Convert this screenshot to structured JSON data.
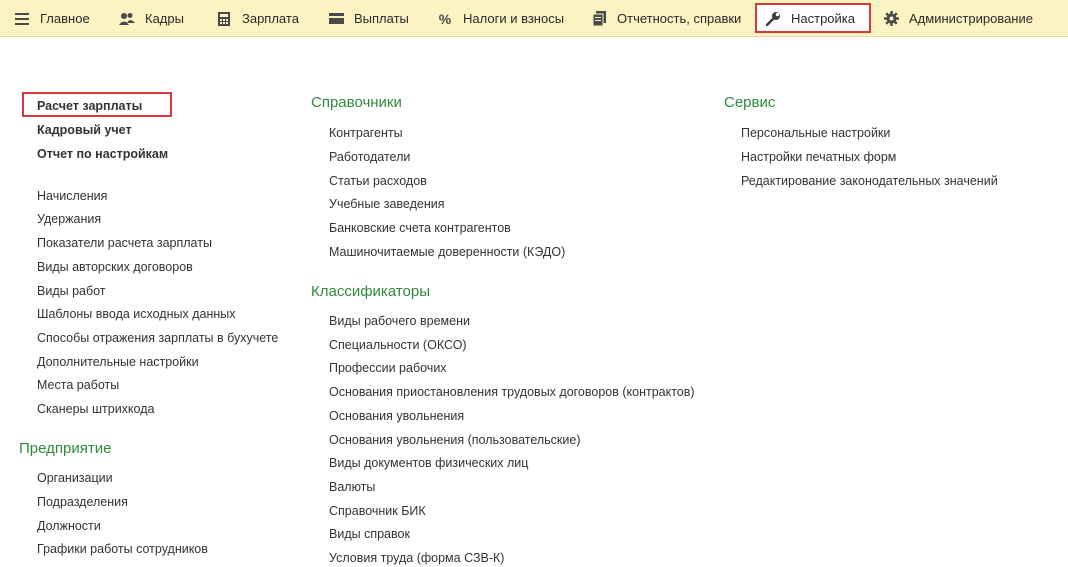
{
  "nav": {
    "main": "Главное",
    "hr": "Кадры",
    "salary": "Зарплата",
    "payments": "Выплаты",
    "taxes": "Налоги и взносы",
    "reports": "Отчетность, справки",
    "settings": "Настройка",
    "admin": "Администрирование",
    "percent_glyph": "%"
  },
  "left": {
    "top_links": [
      "Расчет зарплаты",
      "Кадровый учет",
      "Отчет по настройкам"
    ],
    "links": [
      "Начисления",
      "Удержания",
      "Показатели расчета зарплаты",
      "Виды авторских договоров",
      "Виды работ",
      "Шаблоны ввода исходных данных",
      "Способы отражения зарплаты в бухучете",
      "Дополнительные настройки",
      "Места работы",
      "Сканеры штрихкода"
    ],
    "enterprise_title": "Предприятие",
    "enterprise_links": [
      "Организации",
      "Подразделения",
      "Должности",
      "Графики работы сотрудников"
    ]
  },
  "middle": {
    "refs_title": "Справочники",
    "refs_links": [
      "Контрагенты",
      "Работодатели",
      "Статьи расходов",
      "Учебные заведения",
      "Банковские счета контрагентов",
      "Машиночитаемые доверенности (КЭДО)"
    ],
    "class_title": "Классификаторы",
    "class_links": [
      "Виды рабочего времени",
      "Специальности (ОКСО)",
      "Профессии рабочих",
      "Основания приостановления трудовых договоров (контрактов)",
      "Основания увольнения",
      "Основания увольнения (пользовательские)",
      "Виды документов физических лиц",
      "Валюты",
      "Справочник БИК",
      "Виды справок",
      "Условия труда (форма СЗВ-К)"
    ]
  },
  "right": {
    "service_title": "Сервис",
    "service_links": [
      "Персональные настройки",
      "Настройки печатных форм",
      "Редактирование законодательных значений"
    ]
  },
  "colors": {
    "section": "#2e8b3c",
    "topbar": "#fbf3c1",
    "highlight": "#d7393b"
  },
  "icons": [
    "menu-icon",
    "people-icon",
    "calculator-icon",
    "wallet-icon",
    "percent-icon",
    "documents-icon",
    "wrench-icon",
    "gear-icon"
  ]
}
